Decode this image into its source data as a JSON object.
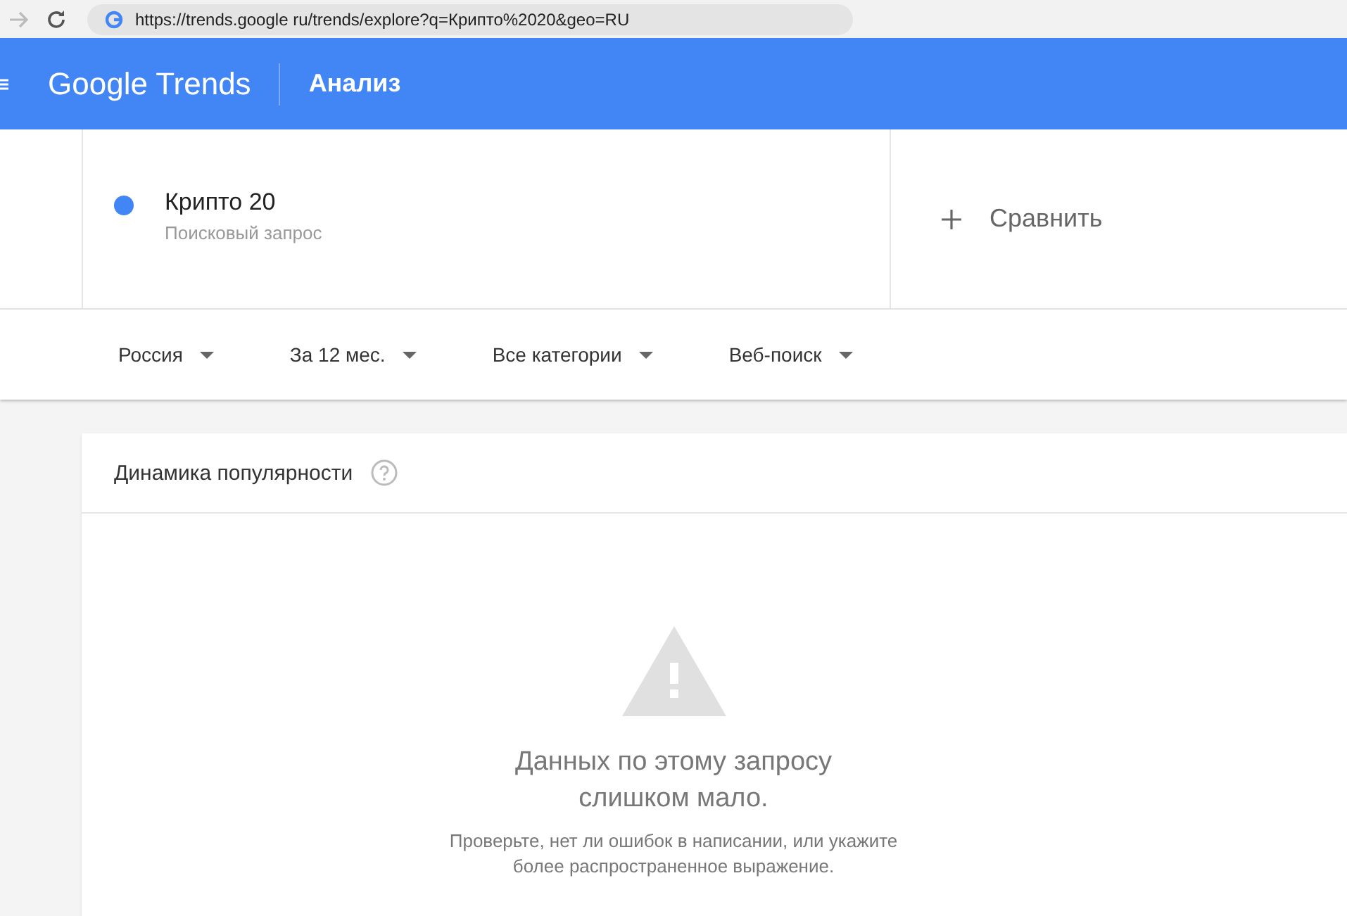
{
  "browser": {
    "url": "https://trends.google ru/trends/explore?q=Крипто%2020&geo=RU"
  },
  "header": {
    "logo": "Google Trends",
    "title": "Анализ"
  },
  "terms": [
    {
      "name": "Крипто 20",
      "type": "Поисковый запрос",
      "color": "#4285f4"
    }
  ],
  "compare": {
    "label": "Сравнить"
  },
  "filters": [
    "Россия",
    "За 12 мес.",
    "Все категории",
    "Веб-поиск"
  ],
  "card": {
    "title": "Динамика популярности",
    "message": "Данных по этому запросу слишком мало.",
    "hint": "Проверьте, нет ли ошибок в написании, или укажите более распространенное выражение."
  }
}
